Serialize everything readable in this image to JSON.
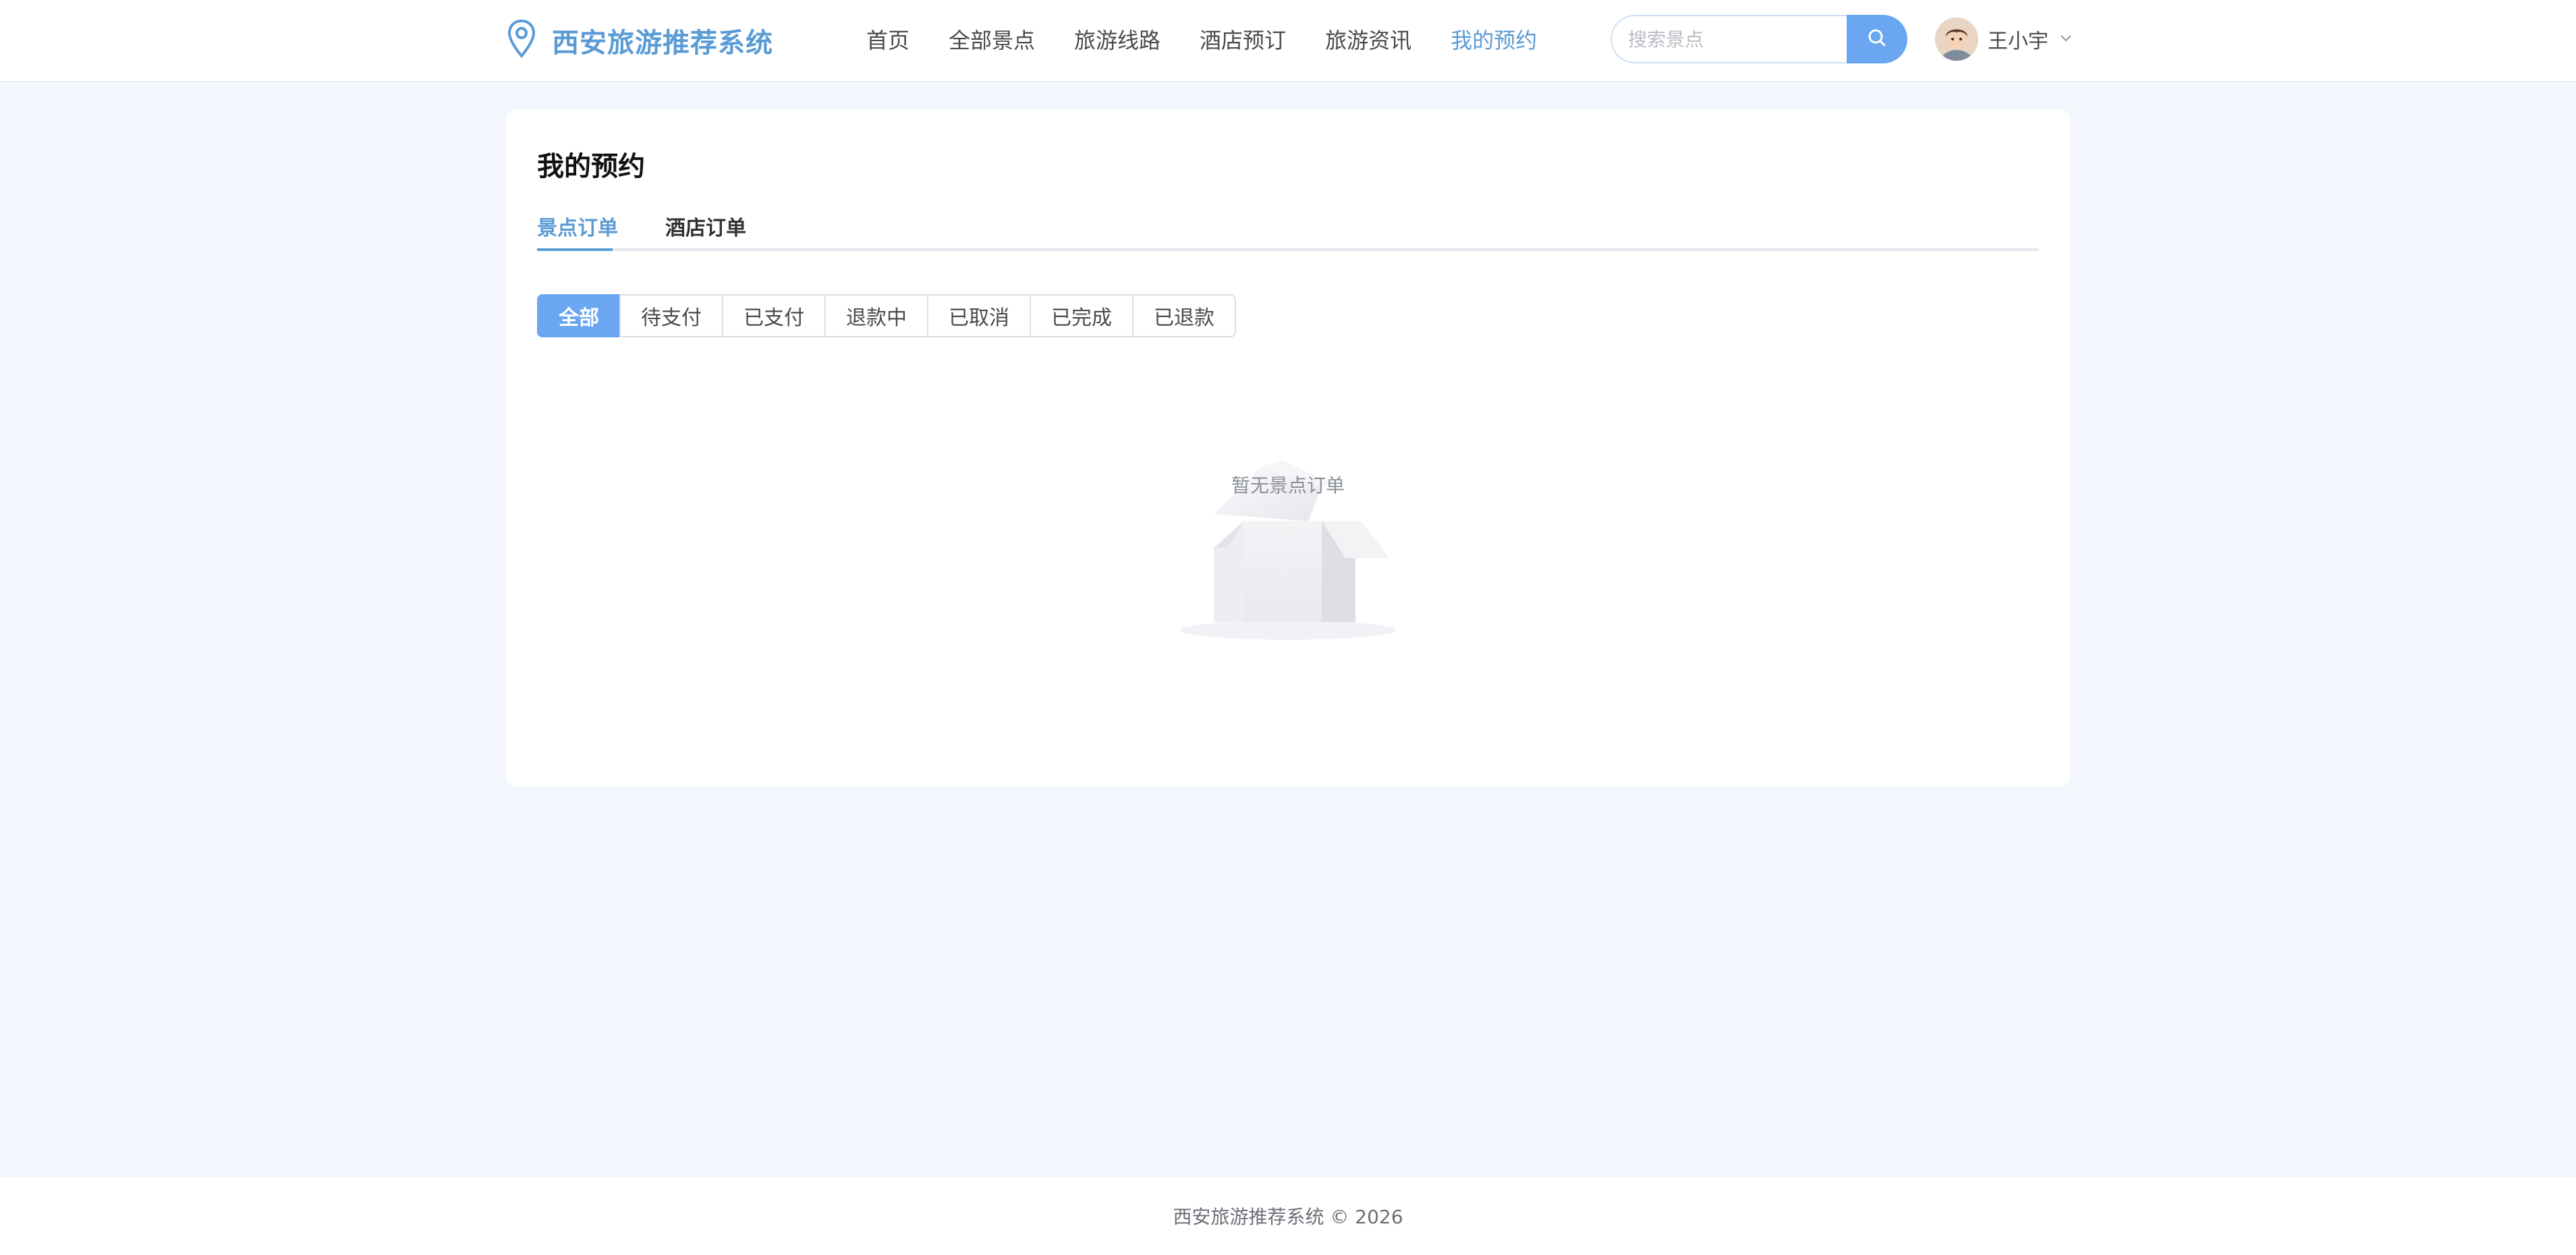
{
  "header": {
    "brand_name": "西安旅游推荐系统",
    "nav": [
      {
        "label": "首页"
      },
      {
        "label": "全部景点"
      },
      {
        "label": "旅游线路"
      },
      {
        "label": "酒店预订"
      },
      {
        "label": "旅游资讯"
      },
      {
        "label": "我的预约"
      }
    ],
    "active_nav": "我的预约",
    "search": {
      "placeholder": "搜索景点",
      "value": ""
    },
    "user": {
      "name": "王小宇"
    }
  },
  "main": {
    "title": "我的预约",
    "tabs": [
      {
        "label": "景点订单"
      },
      {
        "label": "酒店订单"
      }
    ],
    "active_tab": "景点订单",
    "filters": [
      {
        "label": "全部"
      },
      {
        "label": "待支付"
      },
      {
        "label": "已支付"
      },
      {
        "label": "退款中"
      },
      {
        "label": "已取消"
      },
      {
        "label": "已完成"
      },
      {
        "label": "已退款"
      }
    ],
    "active_filter": "全部",
    "empty_text": "暂无景点订单"
  },
  "footer": {
    "text": "西安旅游推荐系统 © 2026"
  },
  "colors": {
    "accent": "#5b9bd5",
    "button": "#6aa7f0",
    "background": "#f3f7fd"
  }
}
